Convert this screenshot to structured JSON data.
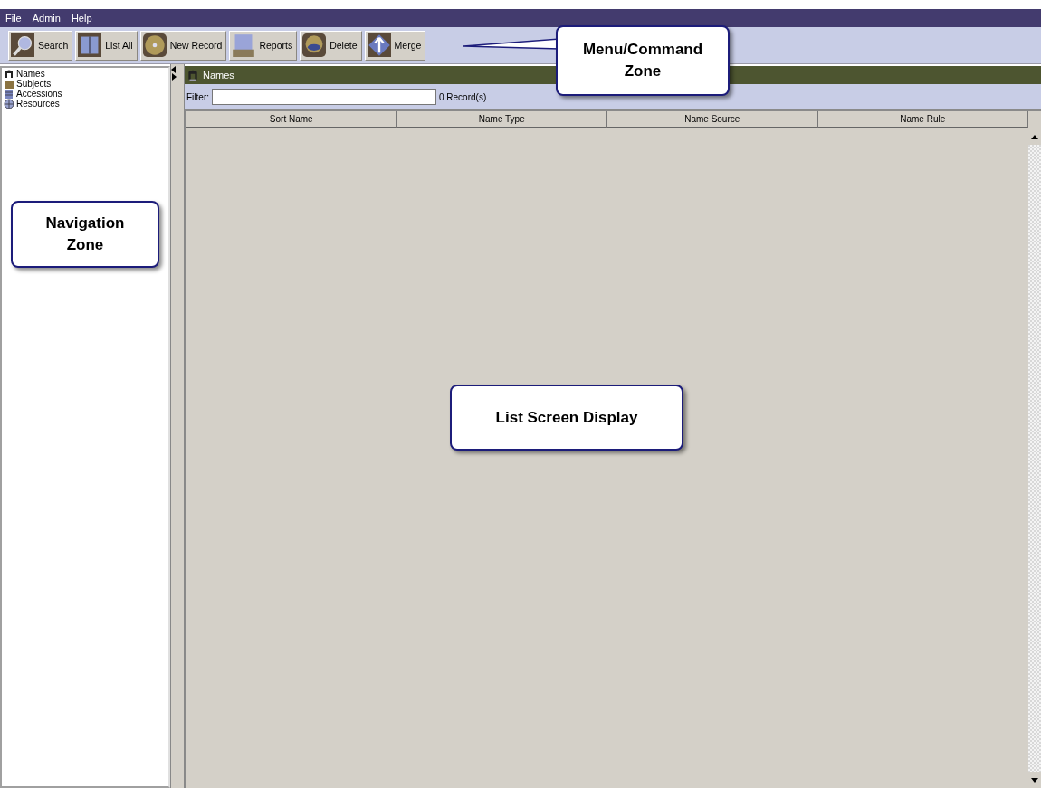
{
  "menu_bar": [
    "File",
    "Admin",
    "Help"
  ],
  "toolbar": [
    {
      "label": "Search"
    },
    {
      "label": "List All"
    },
    {
      "label": "New Record"
    },
    {
      "label": "Reports"
    },
    {
      "label": "Delete"
    },
    {
      "label": "Merge"
    }
  ],
  "navigation": {
    "items": [
      {
        "label": "Names"
      },
      {
        "label": "Subjects"
      },
      {
        "label": "Accessions"
      },
      {
        "label": "Resources"
      }
    ]
  },
  "list_panel": {
    "title": "Names",
    "filter": {
      "label": "Filter:"
    },
    "record_count": "0 Record(s)",
    "columns": [
      "Sort Name",
      "Name Type",
      "Name Source",
      "Name Rule"
    ]
  },
  "callouts": [
    {
      "text": "Menu/Command Zone"
    },
    {
      "text": "Navigation Zone"
    },
    {
      "text": "List Screen Display"
    }
  ]
}
